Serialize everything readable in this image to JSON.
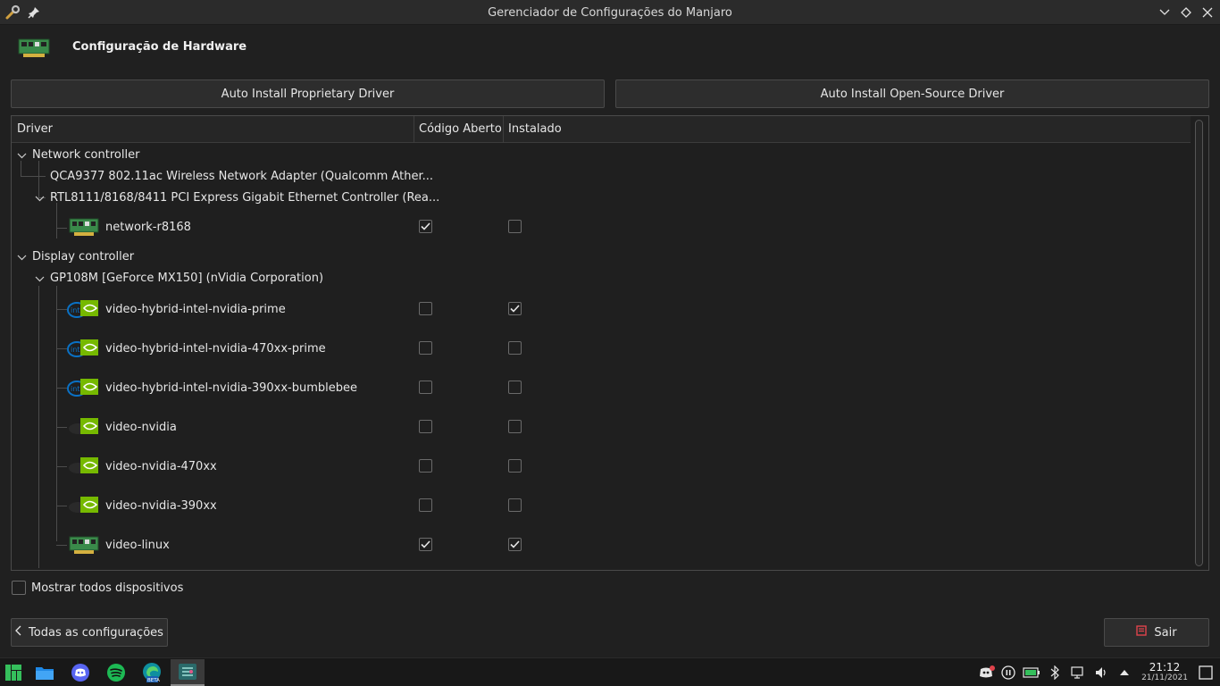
{
  "window": {
    "title": "Gerenciador de Configurações do Manjaro"
  },
  "header": {
    "title": "Configuração de Hardware"
  },
  "actions": {
    "auto_proprietary": "Auto Install Proprietary Driver",
    "auto_open_source": "Auto Install Open-Source Driver"
  },
  "tree": {
    "columns": [
      "Driver",
      "Código Aberto",
      "Instalado"
    ],
    "network_controller": "Network controller",
    "qca_device": "QCA9377 802.11ac Wireless Network Adapter (Qualcomm Ather...",
    "rtl_device": "RTL8111/8168/8411 PCI Express Gigabit Ethernet Controller (Rea...",
    "display_controller": "Display controller",
    "gp108m_device": "GP108M [GeForce MX150] (nVidia Corporation)",
    "drivers": [
      {
        "name": "network-r8168",
        "icon": "network-card-icon",
        "open_source": true,
        "installed": false
      },
      {
        "name": "video-hybrid-intel-nvidia-prime",
        "icon": "intel-nvidia-icon",
        "open_source": false,
        "installed": true
      },
      {
        "name": "video-hybrid-intel-nvidia-470xx-prime",
        "icon": "intel-nvidia-icon",
        "open_source": false,
        "installed": false
      },
      {
        "name": "video-hybrid-intel-nvidia-390xx-bumblebee",
        "icon": "intel-nvidia-icon",
        "open_source": false,
        "installed": false
      },
      {
        "name": "video-nvidia",
        "icon": "nvidia-icon",
        "open_source": false,
        "installed": false
      },
      {
        "name": "video-nvidia-470xx",
        "icon": "nvidia-icon",
        "open_source": false,
        "installed": false
      },
      {
        "name": "video-nvidia-390xx",
        "icon": "nvidia-icon",
        "open_source": false,
        "installed": false
      },
      {
        "name": "video-linux",
        "icon": "network-card-icon",
        "open_source": true,
        "installed": true
      }
    ]
  },
  "footer": {
    "show_all": "Mostrar todos dispositivos",
    "back": "Todas as configurações",
    "quit": "Sair"
  },
  "taskbar": {
    "time": "21:12",
    "date": "21/11/2021",
    "edge_badge": "BETA"
  },
  "colors": {
    "accent_check": "#e6e6e6",
    "nvidia_green": "#76b900",
    "intel_blue": "#0a71c5",
    "pcb_green": "#2e8b57",
    "quit_red": "#e0434b"
  }
}
